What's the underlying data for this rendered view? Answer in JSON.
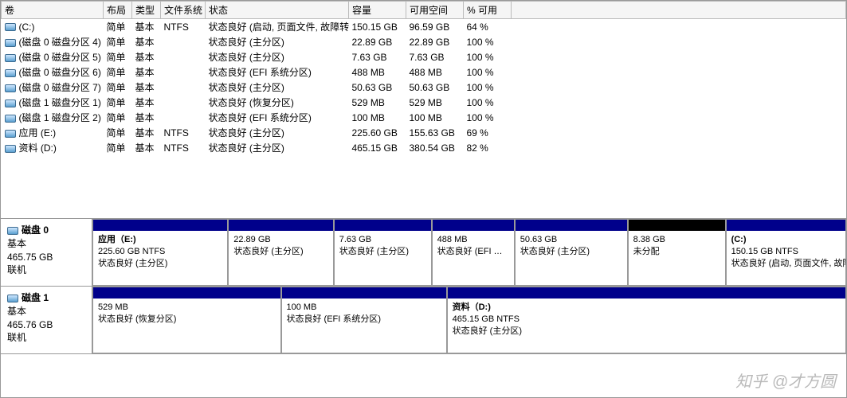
{
  "columns": {
    "vol": "卷",
    "layout": "布局",
    "type": "类型",
    "fs": "文件系统",
    "status": "状态",
    "capacity": "容量",
    "free": "可用空间",
    "pct": "% 可用"
  },
  "rows": [
    {
      "vol": "(C:)",
      "layout": "简单",
      "type": "基本",
      "fs": "NTFS",
      "status": "状态良好 (启动, 页面文件, 故障转储, 主分区)",
      "capacity": "150.15 GB",
      "free": "96.59 GB",
      "pct": "64 %"
    },
    {
      "vol": "(磁盘 0 磁盘分区 4)",
      "layout": "简单",
      "type": "基本",
      "fs": "",
      "status": "状态良好 (主分区)",
      "capacity": "22.89 GB",
      "free": "22.89 GB",
      "pct": "100 %"
    },
    {
      "vol": "(磁盘 0 磁盘分区 5)",
      "layout": "简单",
      "type": "基本",
      "fs": "",
      "status": "状态良好 (主分区)",
      "capacity": "7.63 GB",
      "free": "7.63 GB",
      "pct": "100 %"
    },
    {
      "vol": "(磁盘 0 磁盘分区 6)",
      "layout": "简单",
      "type": "基本",
      "fs": "",
      "status": "状态良好 (EFI 系统分区)",
      "capacity": "488 MB",
      "free": "488 MB",
      "pct": "100 %"
    },
    {
      "vol": "(磁盘 0 磁盘分区 7)",
      "layout": "简单",
      "type": "基本",
      "fs": "",
      "status": "状态良好 (主分区)",
      "capacity": "50.63 GB",
      "free": "50.63 GB",
      "pct": "100 %"
    },
    {
      "vol": "(磁盘 1 磁盘分区 1)",
      "layout": "简单",
      "type": "基本",
      "fs": "",
      "status": "状态良好 (恢复分区)",
      "capacity": "529 MB",
      "free": "529 MB",
      "pct": "100 %"
    },
    {
      "vol": "(磁盘 1 磁盘分区 2)",
      "layout": "简单",
      "type": "基本",
      "fs": "",
      "status": "状态良好 (EFI 系统分区)",
      "capacity": "100 MB",
      "free": "100 MB",
      "pct": "100 %"
    },
    {
      "vol": "应用 (E:)",
      "layout": "简单",
      "type": "基本",
      "fs": "NTFS",
      "status": "状态良好 (主分区)",
      "capacity": "225.60 GB",
      "free": "155.63 GB",
      "pct": "69 %"
    },
    {
      "vol": "资料 (D:)",
      "layout": "简单",
      "type": "基本",
      "fs": "NTFS",
      "status": "状态良好 (主分区)",
      "capacity": "465.15 GB",
      "free": "380.54 GB",
      "pct": "82 %"
    }
  ],
  "disks": [
    {
      "name": "磁盘 0",
      "type": "基本",
      "size": "465.75 GB",
      "state": "联机",
      "parts": [
        {
          "pname": "应用（E:)",
          "line2": "225.60 GB NTFS",
          "line3": "状态良好 (主分区)",
          "pct": 18,
          "cls": ""
        },
        {
          "pname": "",
          "line2": "22.89 GB",
          "line3": "状态良好 (主分区)",
          "pct": 14,
          "cls": ""
        },
        {
          "pname": "",
          "line2": "7.63 GB",
          "line3": "状态良好 (主分区)",
          "pct": 13,
          "cls": ""
        },
        {
          "pname": "",
          "line2": "488 MB",
          "line3": "状态良好 (EFI …",
          "pct": 11,
          "cls": ""
        },
        {
          "pname": "",
          "line2": "50.63 GB",
          "line3": "状态良好 (主分区)",
          "pct": 15,
          "cls": ""
        },
        {
          "pname": "",
          "line2": "8.38 GB",
          "line3": "未分配",
          "pct": 13,
          "cls": "unalloc"
        },
        {
          "pname": "(C:)",
          "line2": "150.15 GB NTFS",
          "line3": "状态良好 (启动, 页面文件, 故障…",
          "pct": 16,
          "cls": ""
        }
      ]
    },
    {
      "name": "磁盘 1",
      "type": "基本",
      "size": "465.76 GB",
      "state": "联机",
      "parts": [
        {
          "pname": "",
          "line2": "529 MB",
          "line3": "状态良好 (恢复分区)",
          "pct": 25,
          "cls": ""
        },
        {
          "pname": "",
          "line2": "100 MB",
          "line3": "状态良好 (EFI 系统分区)",
          "pct": 22,
          "cls": ""
        },
        {
          "pname": "资料（D:)",
          "line2": "465.15 GB NTFS",
          "line3": "状态良好 (主分区)",
          "pct": 53,
          "cls": ""
        }
      ]
    }
  ],
  "watermark": "知乎 @才方圆"
}
